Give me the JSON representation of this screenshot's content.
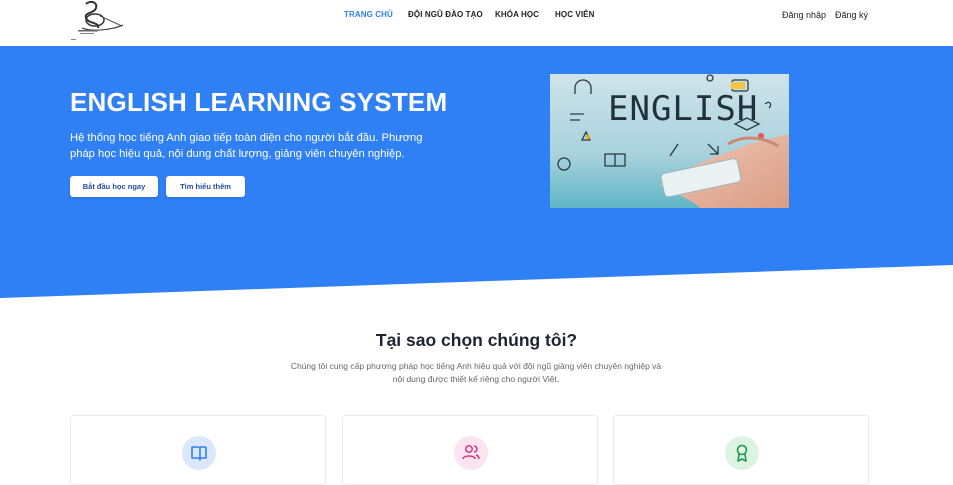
{
  "nav": {
    "items": [
      {
        "label": "TRANG CHỦ",
        "active": true
      },
      {
        "label": "ĐỘI NGŨ ĐÀO TẠO",
        "active": false
      },
      {
        "label": "KHÓA HỌC",
        "active": false
      },
      {
        "label": "HỌC VIÊN",
        "active": false
      }
    ],
    "login": "Đăng nhập",
    "register": "Đăng ký"
  },
  "hero": {
    "title": "ENGLISH LEARNING SYSTEM",
    "description": "Hệ thống học tiếng Anh giao tiếp toàn diện cho người bắt đầu. Phương pháp học hiệu quả, nội dung chất lượng, giảng viên chuyên nghiệp.",
    "primary_button": "Bắt đầu học ngay",
    "secondary_button": "Tìm hiểu thêm",
    "image_word": "ENGLISH"
  },
  "why": {
    "title": "Tại sao chọn chúng tôi?",
    "description": "Chúng tôi cung cấp phương pháp học tiếng Anh hiệu quả với đội ngũ giảng viên chuyên nghiệp và nội dung được thiết kế riêng cho người Việt.",
    "cards": [
      {
        "icon": "book-icon",
        "icon_bg": "#dbe8fb",
        "icon_color": "#2f80f5"
      },
      {
        "icon": "users-icon",
        "icon_bg": "#fbe3f0",
        "icon_color": "#d63384"
      },
      {
        "icon": "award-icon",
        "icon_bg": "#dcf5e3",
        "icon_color": "#1f9a4a"
      }
    ]
  },
  "colors": {
    "brand_blue": "#2f80f5",
    "hero_bg": "#2f80f5",
    "text_dark": "#1e2430"
  }
}
